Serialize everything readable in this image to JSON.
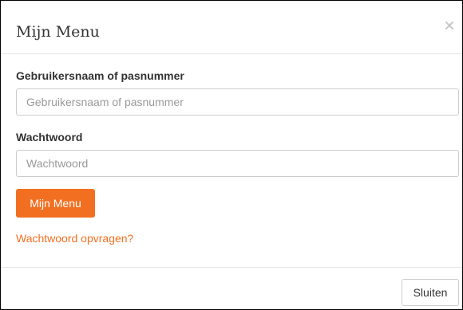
{
  "modal": {
    "title": "Mijn Menu",
    "close_icon": "close-icon"
  },
  "form": {
    "username_label": "Gebruikersnaam of pasnummer",
    "username_placeholder": "Gebruikersnaam of pasnummer",
    "password_label": "Wachtwoord",
    "password_placeholder": "Wachtwoord",
    "submit_label": "Mijn Menu",
    "forgot_link": "Wachtwoord opvragen?"
  },
  "footer": {
    "close_label": "Sluiten"
  },
  "colors": {
    "accent": "#f26f21"
  }
}
